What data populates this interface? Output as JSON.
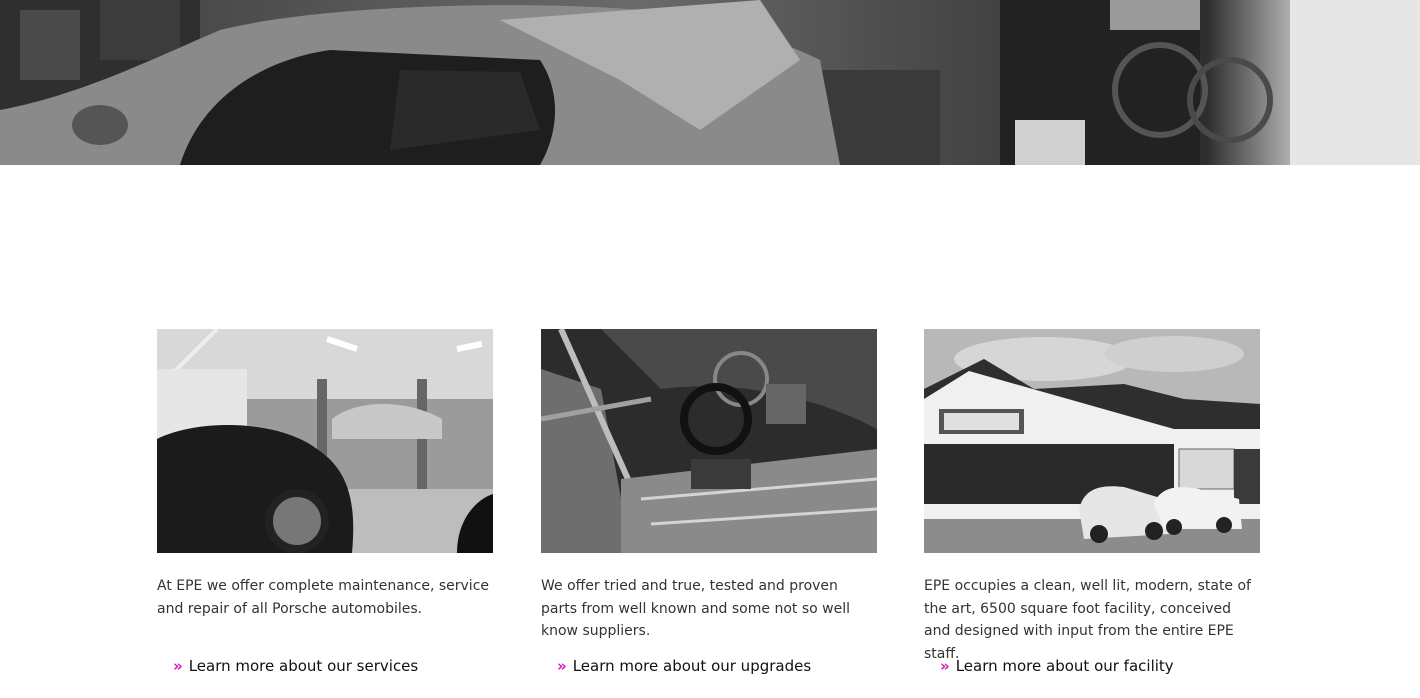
{
  "hero": {
    "icon": "hero-garage-photo"
  },
  "colors": {
    "accent": "#cc1bb4",
    "text": "#333333",
    "link": "#111111"
  },
  "cards": [
    {
      "icon": "shop-floor-photo",
      "description": "At EPE we offer complete maintenance, service and repair of all Porsche automobiles.",
      "link_label": "Learn more about our services"
    },
    {
      "icon": "race-car-interior-photo",
      "description": "We offer tried and true, tested and proven parts from well known and some not so well know suppliers.",
      "link_label": "Learn more about our upgrades"
    },
    {
      "icon": "facility-building-photo",
      "description": "EPE occupies a clean, well lit, modern, state of the art, 6500 square foot facility, conceived and designed with input from the entire EPE staff.",
      "link_label": "Learn more about our facility"
    }
  ]
}
